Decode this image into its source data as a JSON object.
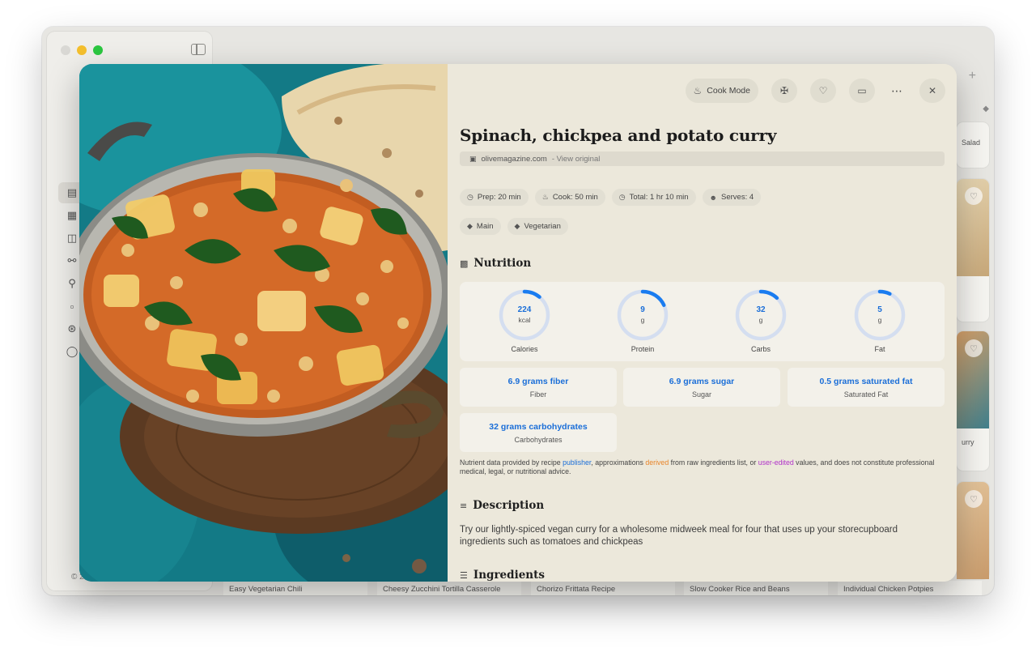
{
  "background_app": {
    "copyright_text": "© 2",
    "right_card_labels": [
      "Salad",
      "urry"
    ],
    "bottom_cards": [
      "Easy Vegetarian Chili",
      "Cheesy Zucchini Tortilla Casserole",
      "Chorizo Frittata Recipe",
      "Slow Cooker Rice and Beans",
      "Individual Chicken Potpies"
    ],
    "plus_label": "+"
  },
  "toolbar": {
    "cook_mode_label": "Cook Mode",
    "more_label": "⋯"
  },
  "recipe": {
    "title": "Spinach, chickpea and potato curry",
    "source": "olivemagazine.com",
    "view_original": "- View original",
    "times": {
      "prep": "Prep: 20 min",
      "cook": "Cook: 50 min",
      "total": "Total: 1 hr 10 min",
      "serves": "Serves: 4"
    },
    "tags": [
      "Main",
      "Vegetarian"
    ]
  },
  "nutrition": {
    "heading": "Nutrition",
    "rings": [
      {
        "value": "224",
        "unit": "kcal",
        "label": "Calories",
        "fraction": 0.11
      },
      {
        "value": "9",
        "unit": "g",
        "label": "Protein",
        "fraction": 0.18
      },
      {
        "value": "32",
        "unit": "g",
        "label": "Carbs",
        "fraction": 0.12
      },
      {
        "value": "5",
        "unit": "g",
        "label": "Fat",
        "fraction": 0.07
      }
    ],
    "facts": [
      {
        "value": "6.9 grams fiber",
        "label": "Fiber"
      },
      {
        "value": "6.9 grams sugar",
        "label": "Sugar"
      },
      {
        "value": "0.5 grams saturated fat",
        "label": "Saturated Fat"
      },
      {
        "value": "32 grams carbohydrates",
        "label": "Carbohydrates"
      }
    ],
    "disclaimer": {
      "part1": "Nutrient data provided by recipe ",
      "publisher": "publisher",
      "part2": ", approximations ",
      "derived": "derived",
      "part3": " from raw ingredients list, or ",
      "user_edited": "user-edited",
      "part4": " values, and does not constitute professional medical, legal, or nutritional advice."
    }
  },
  "description": {
    "heading": "Description",
    "text": "Try our lightly-spiced vegan curry for a wholesome midweek meal for four that uses up your storecupboard ingredients such as tomatoes and chickpeas"
  },
  "ingredients": {
    "heading": "Ingredients"
  },
  "colors": {
    "accent_blue": "#1a6ed8",
    "derived_orange": "#e8842a",
    "edited_purple": "#b032c9",
    "panel_bg": "#ece8db"
  }
}
